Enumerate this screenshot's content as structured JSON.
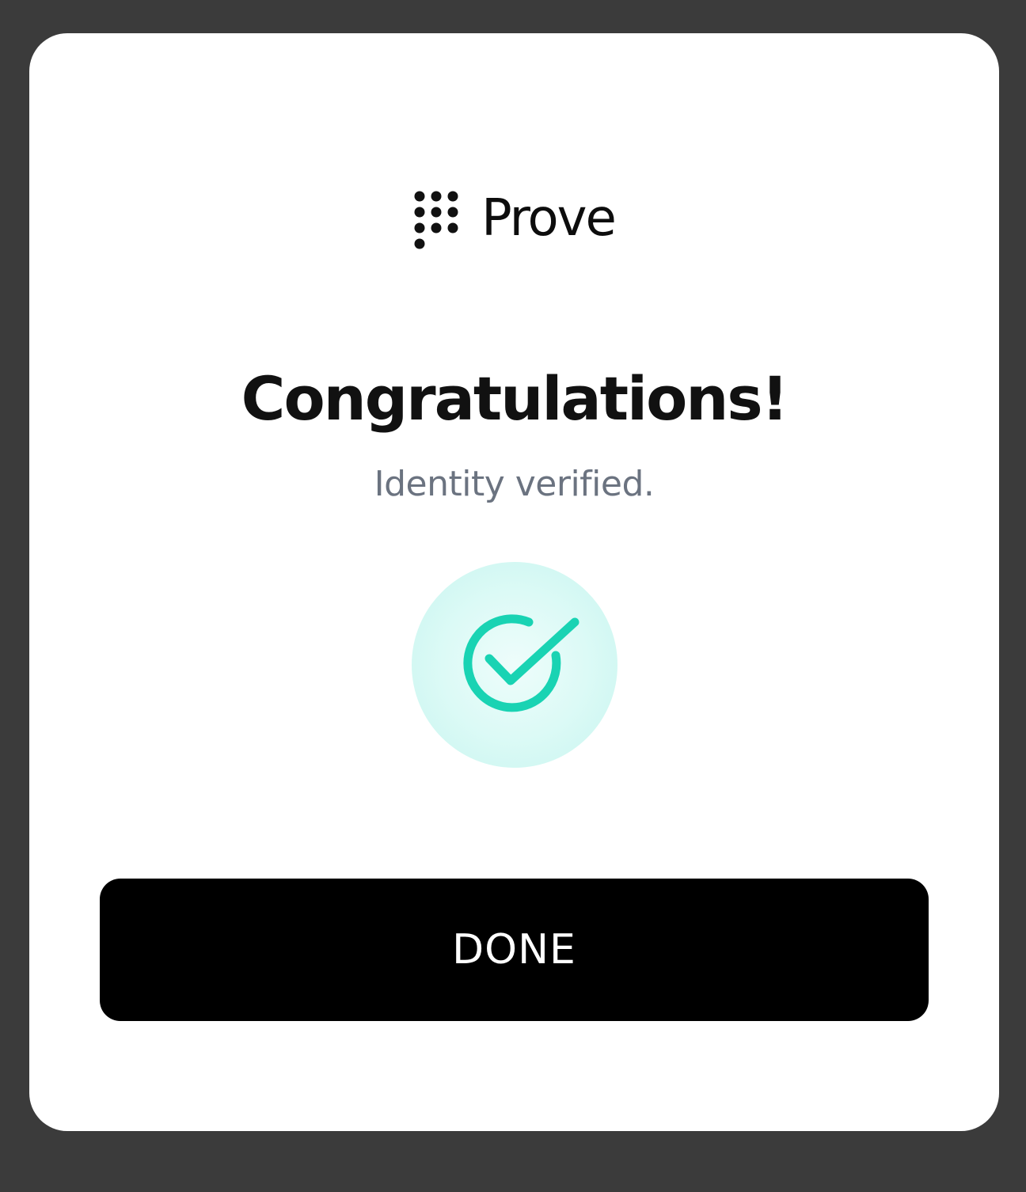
{
  "brand": {
    "name": "Prove",
    "logo_icon": "prove-keypad-dots-icon"
  },
  "title": "Congratulations!",
  "subtitle": "Identity verified.",
  "status_icon": "check-circle-icon",
  "done_button": {
    "label": "DONE"
  },
  "colors": {
    "backdrop": "#3b3b3b",
    "card": "#ffffff",
    "accent": "#19d3b3",
    "accent_halo": "#d9fbf7",
    "button": "#000000",
    "button_text": "#ffffff",
    "subtitle_text": "#6b7380"
  }
}
